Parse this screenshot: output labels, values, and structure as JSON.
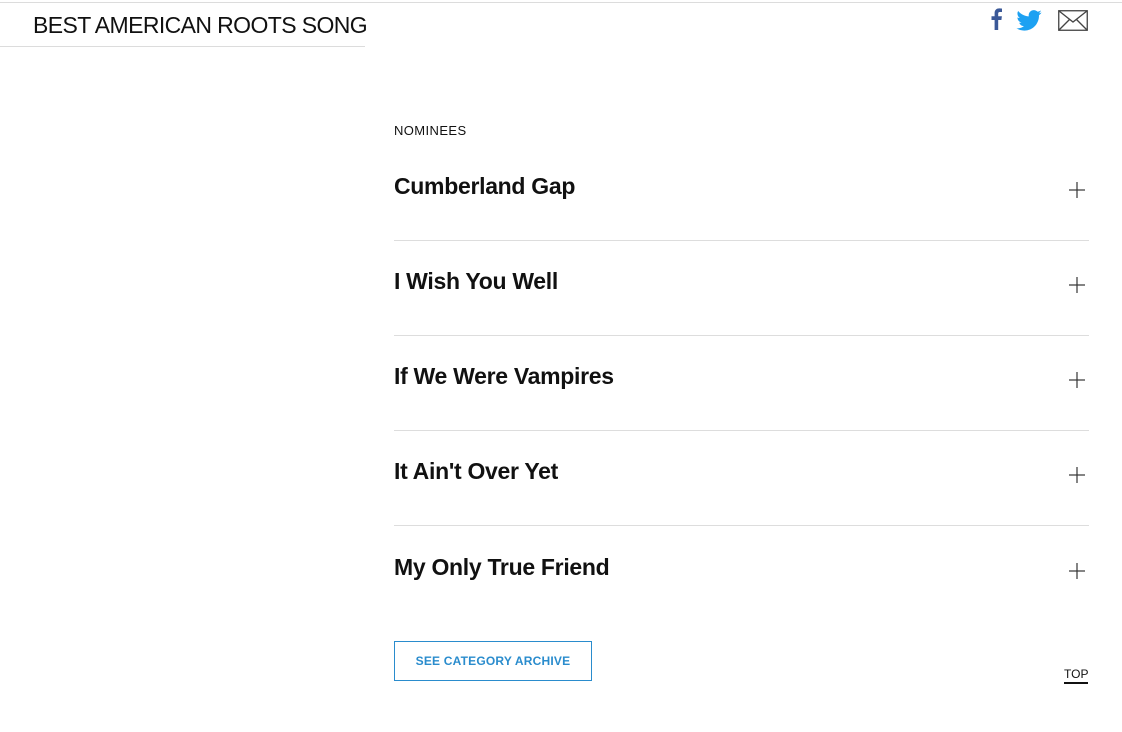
{
  "header": {
    "category_title": "BEST AMERICAN ROOTS SONG"
  },
  "share": {
    "icons": [
      "facebook-icon",
      "twitter-icon",
      "mail-icon"
    ],
    "colors": {
      "facebook": "#3b5998",
      "twitter": "#1da1f2",
      "mail": "#444444"
    }
  },
  "main": {
    "section_label": "NOMINEES",
    "nominees": [
      {
        "title": "Cumberland Gap"
      },
      {
        "title": "I Wish You Well"
      },
      {
        "title": "If We Were Vampires"
      },
      {
        "title": "It Ain't Over Yet"
      },
      {
        "title": "My Only True Friend"
      }
    ],
    "expand_icon": "plus-icon",
    "archive_button_label": "SEE CATEGORY ARCHIVE",
    "top_link_label": "TOP"
  },
  "colors": {
    "accent": "#2a8ccd",
    "divider": "#dddddd",
    "text": "#111111"
  }
}
